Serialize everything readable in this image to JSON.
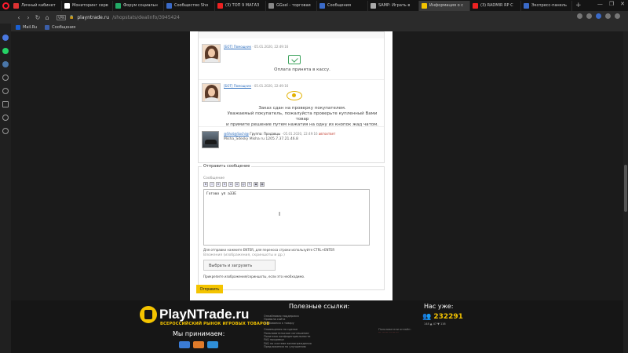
{
  "tabs": [
    {
      "label": "Личный кабинет",
      "color": "#d33"
    },
    {
      "label": "Мониторинг серв",
      "color": "#fff"
    },
    {
      "label": "Форум социальн",
      "color": "#2a6"
    },
    {
      "label": "Сообщество Sho",
      "color": "#3a6ac8"
    },
    {
      "label": "(3) ТОП 9 МАГАЗ",
      "color": "#e22"
    },
    {
      "label": "GGsel - торговая",
      "color": "#888"
    },
    {
      "label": "Сообщения",
      "color": "#3a6ac8"
    },
    {
      "label": "SAMP: Играть в",
      "color": "#aaa"
    },
    {
      "label": "Информация о с",
      "color": "#f4c400"
    },
    {
      "label": "(3) RADMIR RP C",
      "color": "#e22"
    },
    {
      "label": "Экспресс-панель",
      "color": "#3a6ac8"
    }
  ],
  "address": {
    "vpn": "VPN",
    "domain": "playntrade.ru",
    "path": "/shopstats/dealinfo/3945424"
  },
  "bookmarks": [
    {
      "label": "Mail.Ru"
    },
    {
      "label": "Сообщения"
    }
  ],
  "chat": {
    "messages": [
      {
        "author": "[БОТ] Помощник",
        "time": "05.01.2020, 22:49:16",
        "text": "Оплата принята в кассу."
      },
      {
        "author": "[БОТ] Помощник",
        "time": "05.01.2020, 22:49:16",
        "lines": [
          "Заказ сдан на проверку покупателем.",
          "Уважаемый покупатель, пожалуйста проверьте купленный Вами товар",
          "и примите решение путем нажатия на одну из кнопок жад чатом."
        ]
      },
      {
        "author": "@Shot@Sochi@",
        "group": "Группа: Продавцы",
        "time": "05.01.2020, 22:49:16",
        "tag": "автоответ",
        "text": "Misha_Sdesky Misha ru 1205.7.37.21.46.8"
      }
    ]
  },
  "form": {
    "legend": "Отправить сообщение",
    "field_label": "Сообщение",
    "toolbar": [
      "B",
      "I",
      "U",
      "S",
      "≡",
      "≡",
      "☺",
      "✎",
      "▣",
      "▦"
    ],
    "text": "Готово уп аЗЗЕ",
    "hint": "Для отправки нажмите ENTER, для переноса строки используйте CTRL+ENTER",
    "attach_label": "Вложения (изображения, скриншоты и др.)",
    "file_button": "Выбрать и загрузить",
    "attach_hint": "Прикрепите изображения/скриншоты, если это необходимо.",
    "send_label": "Отправить"
  },
  "footer": {
    "logo": "PlayNTrade.ru",
    "logo_sub": "ВСЕРОССИЙСКИЙ РЫНОК ИГРОВЫХ ТОВАРОВ",
    "pay_title": "Мы принимаем:",
    "links_title": "Полезные ссылки:",
    "links": [
      "Онлайновая поддержка",
      "Правила сайта",
      "Требования к товару",
      "",
      "Оповещения по сделке",
      "Пользовательское соглашение",
      "Политика конфиденциальности",
      "FAQ продавца",
      "FAQ по системе вознаграждения",
      "Предложения по улучшению"
    ],
    "stats_title": "Нас уже:",
    "stats_num": "232291",
    "stats_small": "148 ▲ 47 ▼ 116",
    "online_label": "Пользователи онлайн:"
  }
}
